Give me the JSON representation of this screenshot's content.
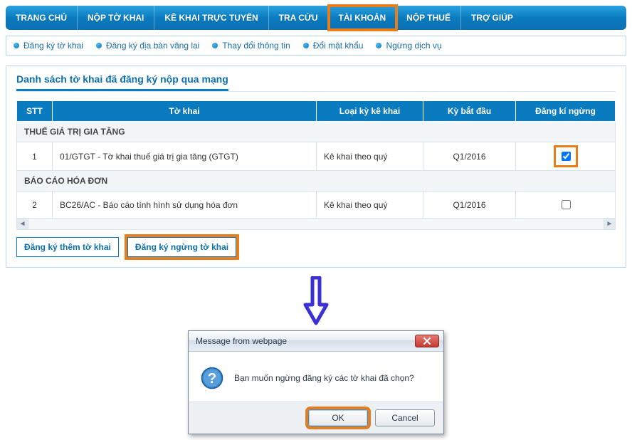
{
  "nav": {
    "tabs": [
      {
        "label": "TRANG CHỦ"
      },
      {
        "label": "NỘP TỜ KHAI"
      },
      {
        "label": "KÊ KHAI TRỰC TUYẾN"
      },
      {
        "label": "TRA CỨU"
      },
      {
        "label": "TÀI KHOẢN"
      },
      {
        "label": "NỘP THUẾ"
      },
      {
        "label": "TRỢ GIÚP"
      }
    ]
  },
  "subnav": {
    "items": [
      {
        "label": "Đăng ký tờ khai"
      },
      {
        "label": "Đăng ký địa bàn vãng lai"
      },
      {
        "label": "Thay đổi thông tin"
      },
      {
        "label": "Đổi mật khẩu"
      },
      {
        "label": "Ngừng dịch vụ"
      }
    ]
  },
  "panel": {
    "title": "Danh sách tờ khai đã đăng ký nộp qua mạng"
  },
  "table": {
    "headers": {
      "stt": "STT",
      "tokhai": "Tờ khai",
      "loai": "Loại kỳ kê khai",
      "ky": "Kỳ bắt đầu",
      "dangki": "Đăng kí ngừng"
    },
    "group1": "THUẾ GIÁ TRỊ GIA TĂNG",
    "row1": {
      "stt": "1",
      "tokhai": "01/GTGT - Tờ khai thuế giá trị gia tăng (GTGT)",
      "loai": "Kê khai theo quý",
      "ky": "Q1/2016",
      "checked": true
    },
    "group2": "BÁO CÁO HÓA ĐƠN",
    "row2": {
      "stt": "2",
      "tokhai": "BC26/AC - Báo cáo tình hình sử dụng hóa đơn",
      "loai": "Kê khai theo quý",
      "ky": "Q1/2016",
      "checked": false
    }
  },
  "actions": {
    "add": "Đăng ký thêm tờ khai",
    "stop": "Đăng ký ngừng tờ khai"
  },
  "dialog": {
    "title": "Message from webpage",
    "message": "Bạn muốn ngừng đăng ký các tờ khai đã chọn?",
    "ok": "OK",
    "cancel": "Cancel"
  }
}
